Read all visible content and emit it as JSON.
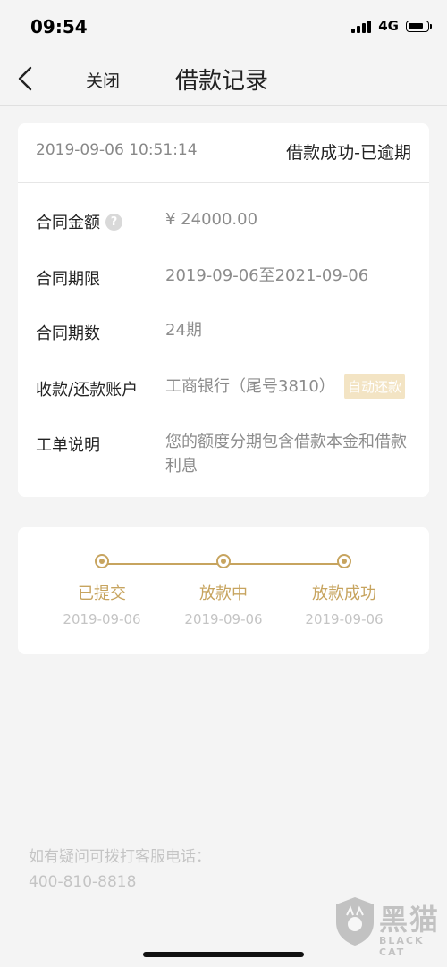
{
  "status_bar": {
    "time": "09:54",
    "network": "4G"
  },
  "nav": {
    "back_icon": "chevron-left-icon",
    "close_label": "关闭",
    "title": "借款记录"
  },
  "record": {
    "datetime": "2019-09-06 10:51:14",
    "status": "借款成功-已逾期",
    "fields": {
      "amount": {
        "label": "合同金额",
        "value": "¥ 24000.00",
        "help_icon": "question-mark-icon"
      },
      "term": {
        "label": "合同期限",
        "value": "2019-09-06至2021-09-06"
      },
      "periods": {
        "label": "合同期数",
        "value": "24期"
      },
      "account": {
        "label": "收款/还款账户",
        "value": "工商银行（尾号3810）",
        "badge": "自动还款"
      },
      "description": {
        "label": "工单说明",
        "value": "您的额度分期包含借款本金和借款利息"
      }
    }
  },
  "progress": {
    "steps": [
      {
        "label": "已提交",
        "date": "2019-09-06"
      },
      {
        "label": "放款中",
        "date": "2019-09-06"
      },
      {
        "label": "放款成功",
        "date": "2019-09-06"
      }
    ]
  },
  "footer": {
    "line1": "如有疑问可拨打客服电话：",
    "phone": "400-810-8818"
  },
  "watermark": {
    "name_cn": "黑猫",
    "name_en": "BLACK CAT"
  },
  "colors": {
    "accent_gold": "#c7a45f",
    "badge_bg": "#f3e4c4",
    "background": "#f4f4f4"
  }
}
